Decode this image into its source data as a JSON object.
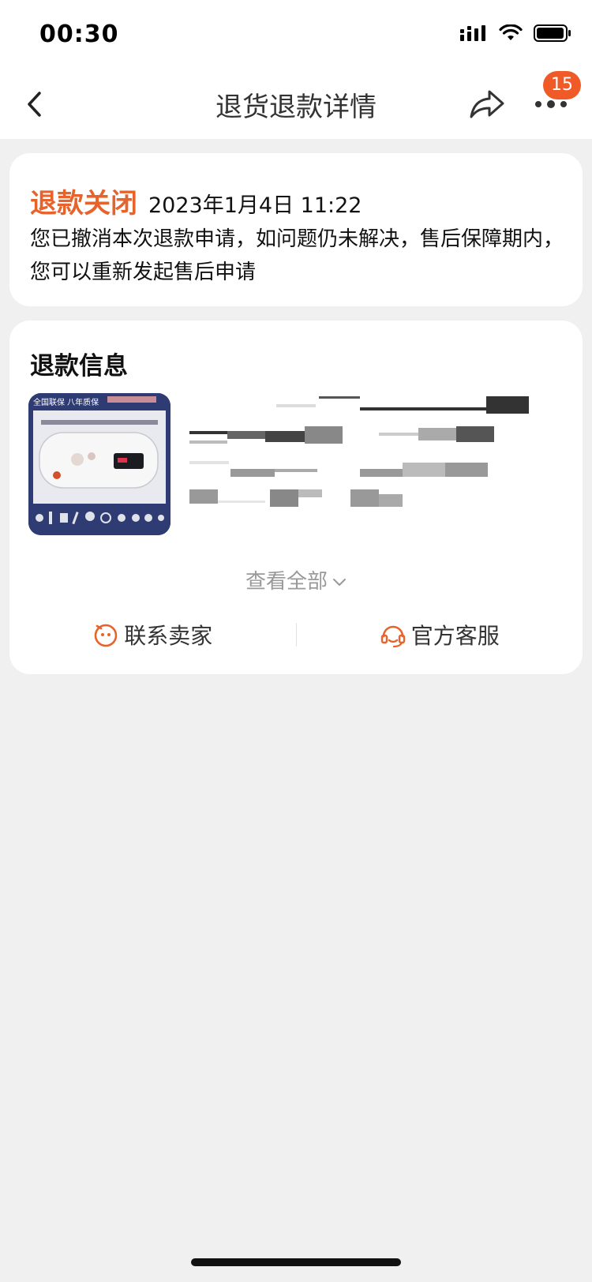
{
  "status_bar": {
    "time": "00:30"
  },
  "nav": {
    "title": "退货退款详情",
    "badge_count": "15"
  },
  "refund_status": {
    "title": "退款关闭",
    "time": "2023年1月4日 11:22",
    "description": "您已撤消本次退款申请，如问题仍未解决，售后保障期内，您可以重新发起售后申请"
  },
  "refund_info": {
    "title": "退款信息",
    "product_image_label": "全国联保 八年质保",
    "view_all_label": "查看全部",
    "contact_seller_label": "联系卖家",
    "official_service_label": "官方客服"
  },
  "colors": {
    "accent": "#e6632c",
    "badge": "#f05a26",
    "background": "#f0f0f0"
  }
}
